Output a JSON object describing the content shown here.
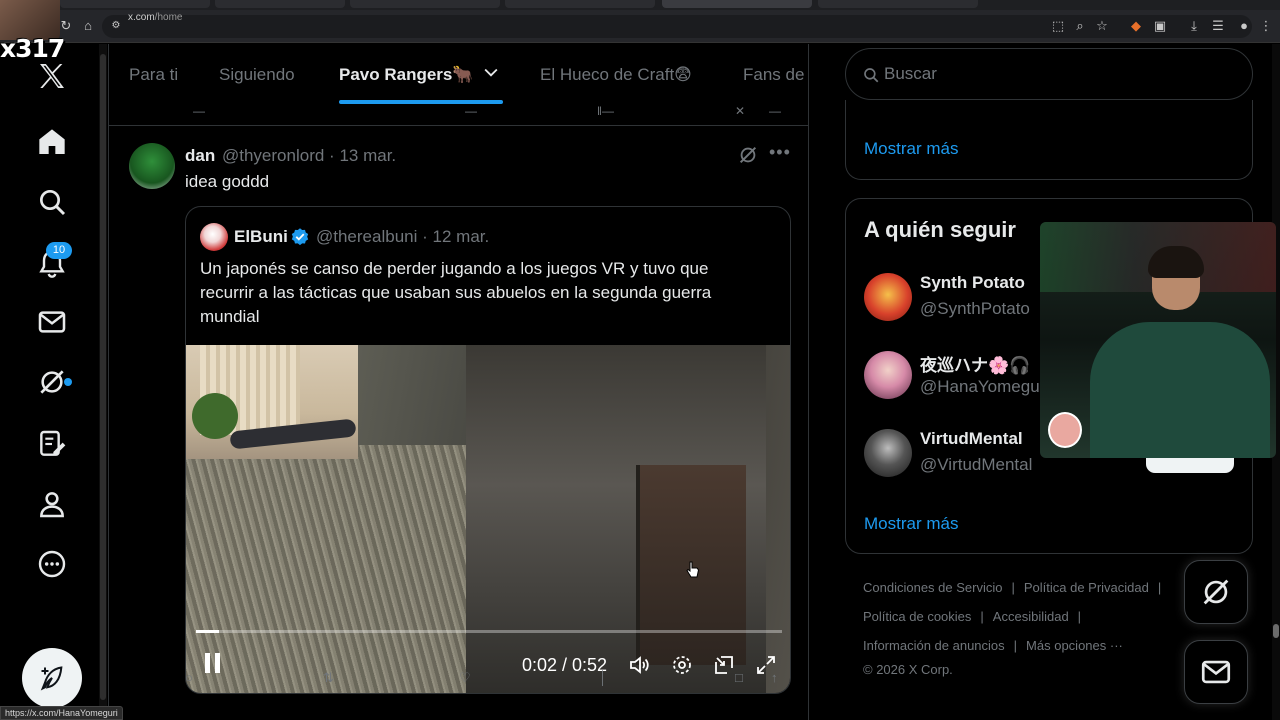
{
  "browser": {
    "url_host": "x.com",
    "url_path": "/home",
    "status_url": "https://x.com/HanaYomeguri"
  },
  "stream_overlay": {
    "counter": "x317"
  },
  "nav": {
    "notifications_badge": "10"
  },
  "feed_tabs": [
    {
      "label": "Para ti"
    },
    {
      "label": "Siguiendo"
    },
    {
      "label": "Pavo Rangers🐂"
    },
    {
      "label": "El Hueco de Craft😨"
    },
    {
      "label": "Fans de"
    }
  ],
  "tweet": {
    "name": "dan",
    "handle": "@thyeronlord",
    "dot": "·",
    "date": "13 mar.",
    "text": "idea goddd",
    "quote": {
      "name": "ElBuni",
      "handle": "@therealbuni",
      "date": "12 mar.",
      "text": "Un japonés se canso de perder jugando a los juegos VR y tuvo que recurrir a las tácticas que usaban sus abuelos en la segunda guerra mundial",
      "video": {
        "time": "0:02 / 0:52",
        "progress": 0.04
      }
    }
  },
  "search": {
    "placeholder": "Buscar"
  },
  "trends": {
    "show_more": "Mostrar más"
  },
  "who_to_follow": {
    "title": "A quién seguir",
    "items": [
      {
        "name": "Synth Potato",
        "handle": "@SynthPotato",
        "avatar_color": "#c0392b"
      },
      {
        "name": "夜巡ハナ🌸🎧",
        "handle": "@HanaYomegu",
        "avatar_color": "#d68aa8"
      },
      {
        "name": "VirtudMental",
        "handle": "@VirtudMental",
        "avatar_color": "#3a3a3a"
      }
    ],
    "show_more": "Mostrar más"
  },
  "footer": {
    "row1": [
      "Condiciones de Servicio",
      "Política de Privacidad"
    ],
    "row2": [
      "Política de cookies",
      "Accesibilidad"
    ],
    "row3": [
      "Información de anuncios",
      "Más opciones ···"
    ],
    "copyright": "© 2026 X Corp."
  },
  "colors": {
    "accent": "#1d9bf0",
    "background": "#000000",
    "border": "#2f3336",
    "muted_text": "#71767b"
  },
  "icons": [
    "x-logo-icon",
    "home-icon",
    "search-icon",
    "bell-icon",
    "mail-icon",
    "grok-icon",
    "notes-icon",
    "profile-icon",
    "more-icon",
    "feather-icon",
    "verified-icon"
  ]
}
